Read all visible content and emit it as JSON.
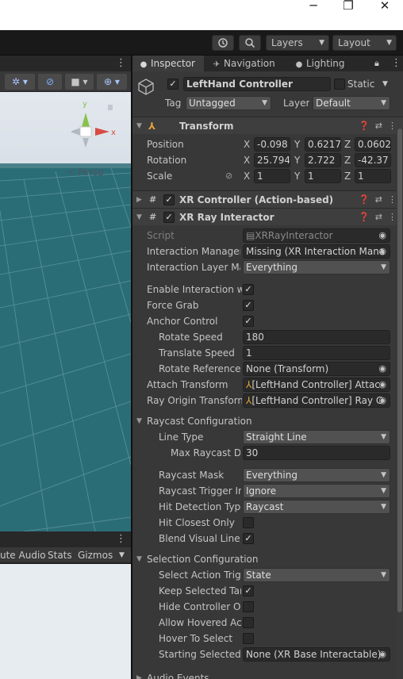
{
  "window": {
    "minimize": "─",
    "maximize": "❐",
    "close": "✕"
  },
  "toolbar": {
    "history_icon": "history-icon",
    "search_icon": "search-icon",
    "layers": "Layers",
    "layout": "Layout"
  },
  "scene": {
    "persp": "< Persp",
    "gizmo_y": "y",
    "gizmo_x": "x",
    "menu": "⋮"
  },
  "bottom": {
    "items": [
      "ute Audio",
      "Stats",
      "Gizmos"
    ]
  },
  "inspector": {
    "tabs": [
      "Inspector",
      "Navigation",
      "Lighting"
    ],
    "object_name": "LeftHand Controller",
    "static_label": "Static",
    "tag_label": "Tag",
    "tag_value": "Untagged",
    "layer_label": "Layer",
    "layer_value": "Default",
    "transform": {
      "title": "Transform",
      "position_label": "Position",
      "position": {
        "x": "-0.098",
        "y": "0.6217",
        "z": "0.0602"
      },
      "rotation_label": "Rotation",
      "rotation": {
        "x": "25.794",
        "y": "2.722",
        "z": "-42.37"
      },
      "scale_label": "Scale",
      "scale": {
        "x": "1",
        "y": "1",
        "z": "1"
      }
    },
    "xr_controller": {
      "title": "XR Controller (Action-based)"
    },
    "xr_ray": {
      "title": "XR Ray Interactor",
      "script_label": "Script",
      "script_value": "XRRayInteractor",
      "im_label": "Interaction Manager",
      "im_value": "Missing (XR Interaction Mana",
      "ilm_label": "Interaction Layer Mas",
      "ilm_value": "Everything",
      "eiw_label": "Enable Interaction wit",
      "force_grab_label": "Force Grab",
      "anchor_label": "Anchor Control",
      "rotate_speed_label": "Rotate Speed",
      "rotate_speed": "180",
      "translate_speed_label": "Translate Speed",
      "translate_speed": "1",
      "rot_ref_label": "Rotate Reference F",
      "rot_ref_value": "None (Transform)",
      "attach_label": "Attach Transform",
      "attach_value": "[LeftHand Controller] Attac",
      "ray_origin_label": "Ray Origin Transform",
      "ray_origin_value": "[LeftHand Controller] Ray C",
      "raycast_section": "Raycast Configuration",
      "line_type_label": "Line Type",
      "line_type": "Straight Line",
      "max_raycast_label": "Max Raycast Di",
      "max_raycast": "30",
      "raycast_mask_label": "Raycast Mask",
      "raycast_mask": "Everything",
      "trigger_label": "Raycast Trigger Int",
      "trigger": "Ignore",
      "hit_det_label": "Hit Detection Type",
      "hit_det": "Raycast",
      "hit_closest_label": "Hit Closest Only",
      "blend_label": "Blend Visual Line P",
      "selection_section": "Selection Configuration",
      "select_action_label": "Select Action Trigg",
      "select_action": "State",
      "keep_selected_label": "Keep Selected Tar",
      "hide_controller_label": "Hide Controller On",
      "allow_hovered_label": "Allow Hovered Act",
      "hover_select_label": "Hover To Select",
      "starting_label": "Starting Selected I",
      "starting_value": "None (XR Base Interactable)",
      "audio_events": "Audio Events"
    }
  }
}
